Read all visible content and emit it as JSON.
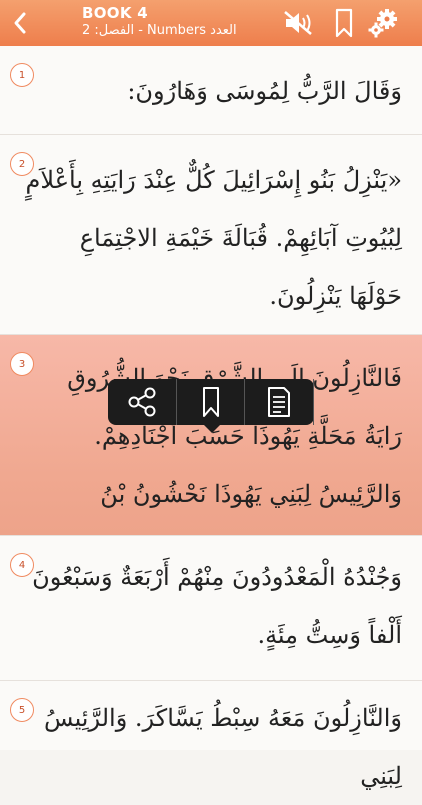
{
  "header": {
    "book": "BOOK 4",
    "subtitle": "العدد Numbers - الفصل: 2",
    "icons": [
      "chevron-left-icon",
      "speaker-mute-icon",
      "bookmark-icon",
      "gear-icon"
    ]
  },
  "verses": [
    {
      "number": "1",
      "text": "وَقَالَ الرَّبُّ لِمُوسَى وَهَارُونَ:"
    },
    {
      "number": "2",
      "text": "«يَنْزِلُ بَنُو إِسْرَائِيلَ كُلٌّ عِنْدَ رَايَتِهِ بِأَعْلاَمٍ لِبُيُوتِ آبَائِهِمْ. قُبَالَةَ خَيْمَةِ الاجْتِمَاعِ حَوْلَهَا يَنْزِلُونَ."
    },
    {
      "number": "3",
      "text": "فَالنَّازِلُونَ إِلَى الشَّرْقِ نَحْوَ الشُّرُوقِ رَايَةُ مَحَلَّةِ يَهُوذَا حَسَبَ أَجْنَادِهِمْ. وَالرَّئِيسُ لِبَنِي يَهُوذَا نَحْشُونُ بْنُ عَمِّينَادَابَ."
    },
    {
      "number": "4",
      "text": "وَجُنْدُهُ الْمَعْدُودُونَ مِنْهُمْ أَرْبَعَةٌ وَسَبْعُونَ أَلْفاً وَسِتُّ مِئَةٍ."
    },
    {
      "number": "5",
      "text": "وَالنَّازِلُونَ مَعَهُ سِبْطُ يَسَّاكَرَ. وَالرَّئِيسُ لِبَنِي"
    }
  ],
  "selected_verse": "3",
  "popup_icons": [
    "share-icon",
    "bookmark-icon",
    "note-icon"
  ],
  "colors": {
    "header": "#ee7e4c",
    "selected": "#f0a890",
    "badge_border": "#f08a60"
  }
}
